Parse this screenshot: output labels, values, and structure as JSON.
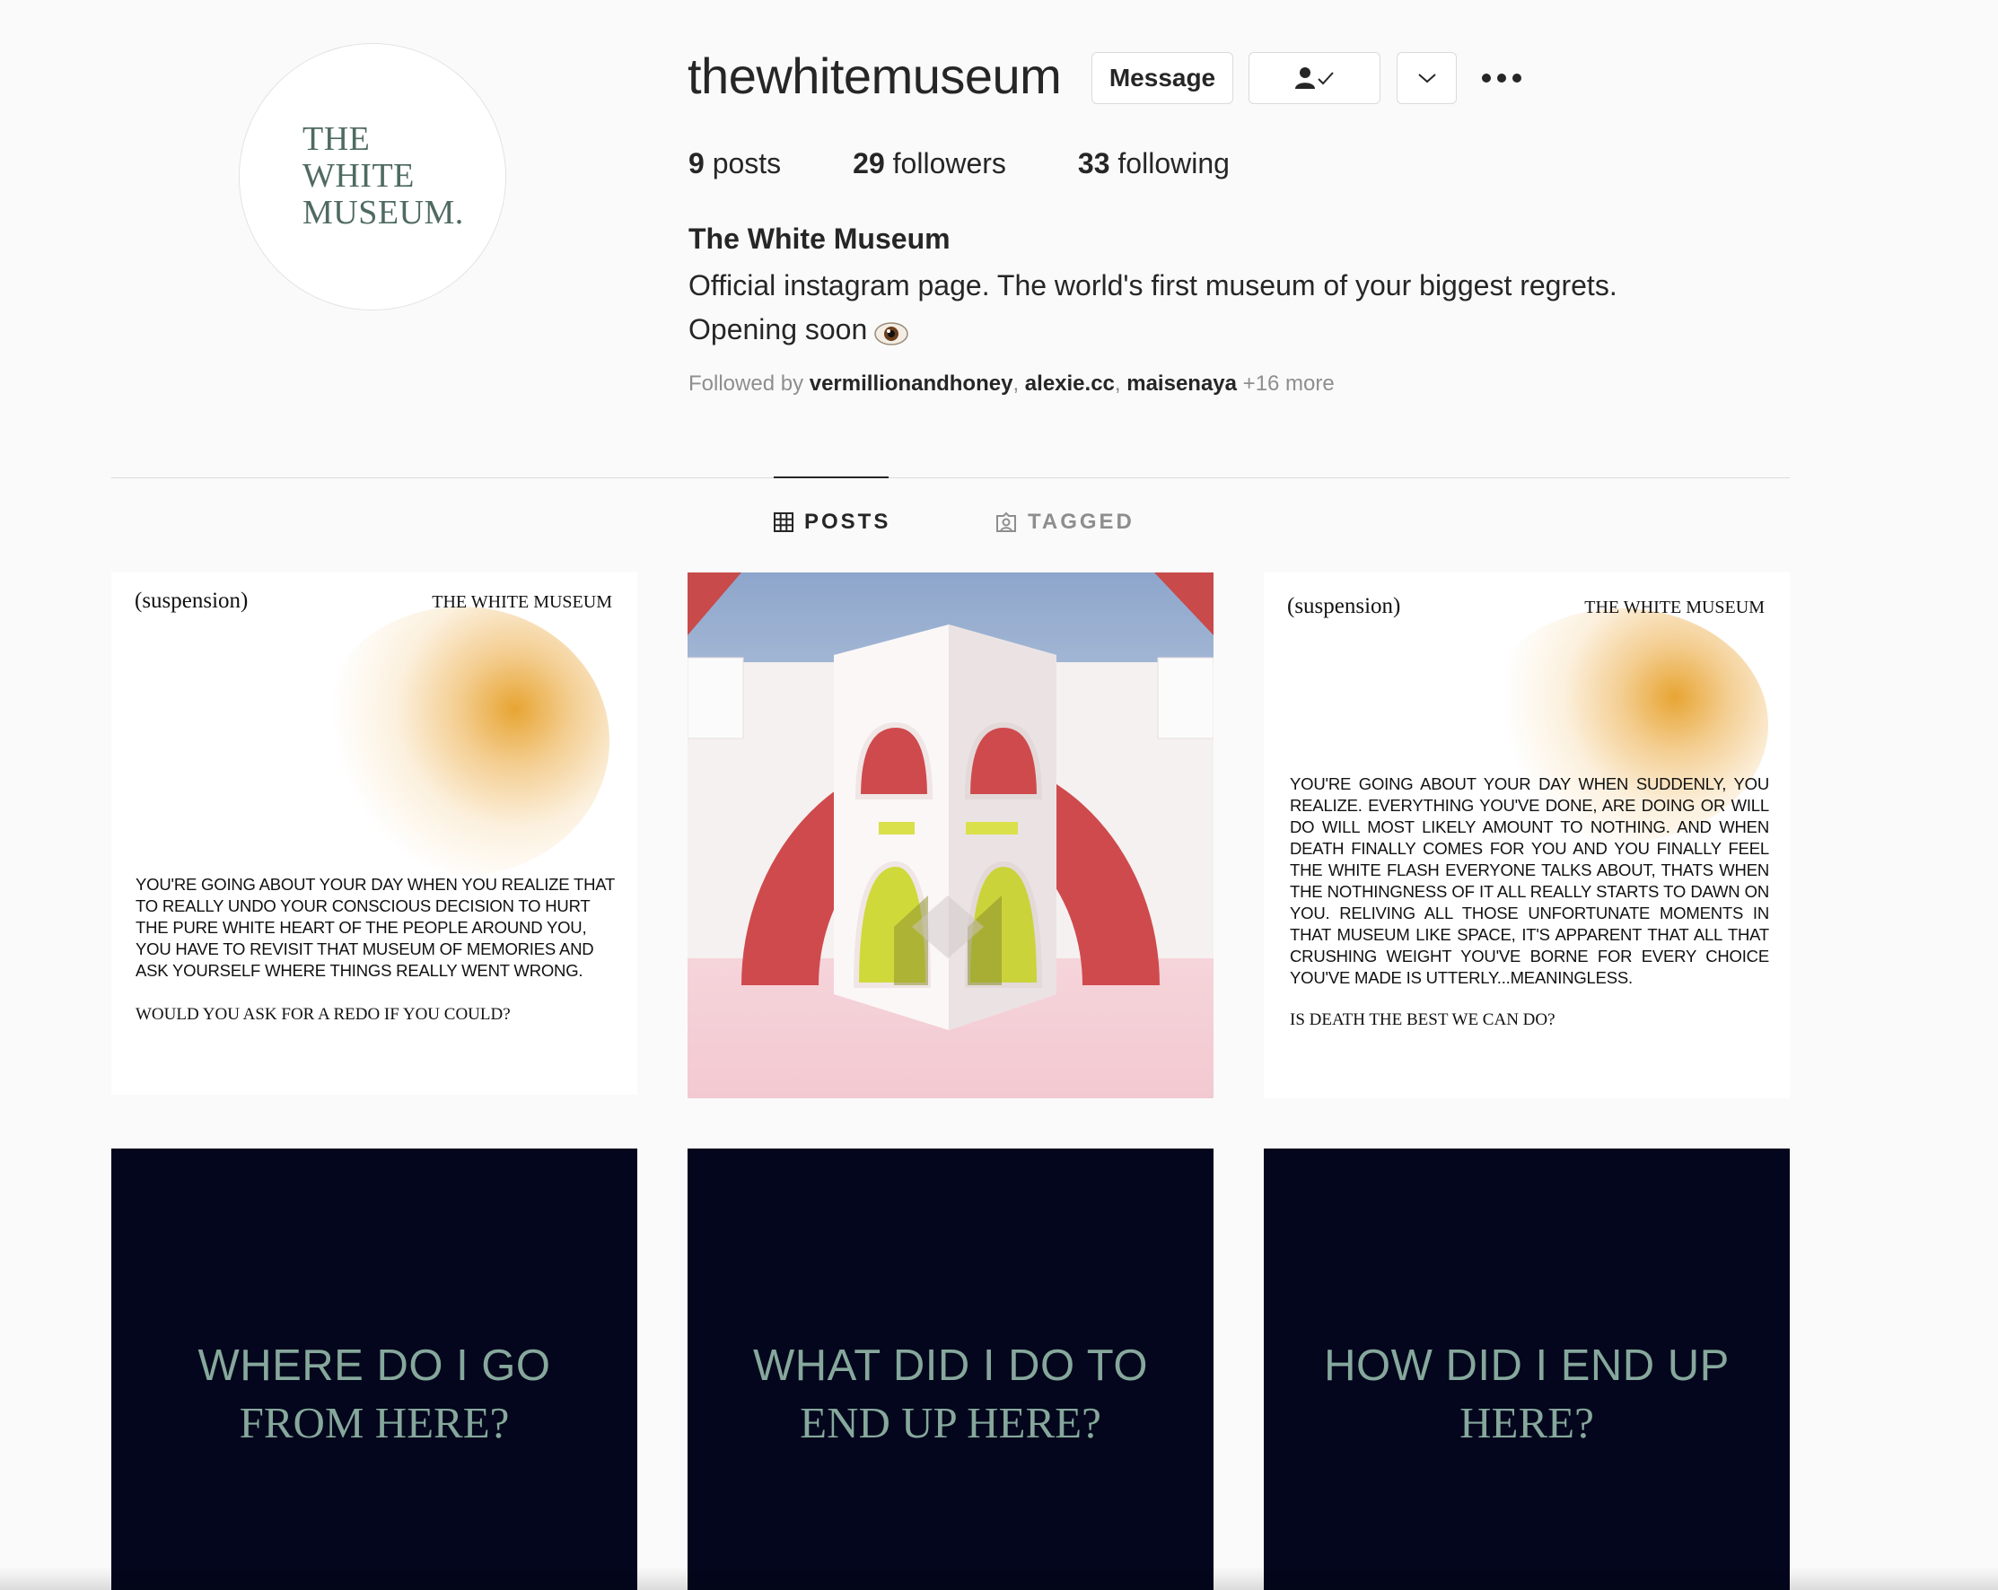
{
  "profile": {
    "avatar_lines": [
      "THE",
      "WHITE",
      "MUSEUM."
    ],
    "username": "thewhitemuseum",
    "message_label": "Message",
    "stats": [
      {
        "value": "9",
        "label": "posts"
      },
      {
        "value": "29",
        "label": "followers"
      },
      {
        "value": "33",
        "label": "following"
      }
    ],
    "full_name": "The White Museum",
    "bio_line1": "Official instagram page. The world's first museum of your biggest regrets.",
    "bio_line2": "Opening soon",
    "followed_prefix": "Followed by",
    "followed_users": [
      "vermillionandhoney",
      "alexie.cc",
      "maisenaya"
    ],
    "followed_more": "+16 more"
  },
  "tabs": [
    {
      "label": "POSTS",
      "active": true,
      "icon": "grid-icon"
    },
    {
      "label": "TAGGED",
      "active": false,
      "icon": "tagged-icon"
    }
  ],
  "posts": {
    "p1": {
      "head_left": "(suspension)",
      "head_right": "THE WHITE MUSEUM",
      "body": "YOU'RE GOING ABOUT YOUR DAY WHEN YOU REALIZE THAT TO REALLY UNDO YOUR CONSCIOUS DECISION TO HURT THE PURE WHITE HEART OF THE PEOPLE AROUND YOU, YOU HAVE TO REVISIT THAT MUSEUM OF MEMORIES AND ASK YOURSELF WHERE THINGS REALLY WENT WRONG.",
      "question": "WOULD YOU ASK FOR A REDO IF YOU COULD?"
    },
    "p3": {
      "head_left": "(suspension)",
      "head_right": "THE WHITE MUSEUM",
      "body": "YOU'RE GOING ABOUT YOUR DAY WHEN SUDDENLY, YOU REALIZE. EVERYTHING YOU'VE DONE, ARE DOING OR WILL DO WILL MOST LIKELY AMOUNT TO NOTHING. AND WHEN DEATH FINALLY COMES FOR YOU AND YOU FINALLY FEEL THE WHITE FLASH EVERYONE TALKS ABOUT, THATS WHEN THE NOTHINGNESS OF IT ALL REALLY STARTS TO DAWN ON YOU. RELIVING ALL THOSE UNFORTUNATE MOMENTS IN THAT MUSEUM LIKE SPACE, IT'S APPARENT THAT ALL THAT CRUSHING WEIGHT YOU'VE BORNE FOR EVERY CHOICE YOU'VE MADE IS UTTERLY...MEANINGLESS.",
      "question": "IS DEATH THE BEST WE CAN DO?"
    },
    "p4": {
      "line1": "WHERE DO I GO",
      "line2": "FROM HERE?"
    },
    "p5": {
      "line1": "WHAT DID I DO TO",
      "line2": "END UP HERE?"
    },
    "p6": {
      "line1": "HOW DID I END UP",
      "line2": "HERE?"
    }
  },
  "colors": {
    "accent_green": "#4f6b61",
    "dark_tile": "#03061c",
    "tile_text": "#86a89c"
  }
}
